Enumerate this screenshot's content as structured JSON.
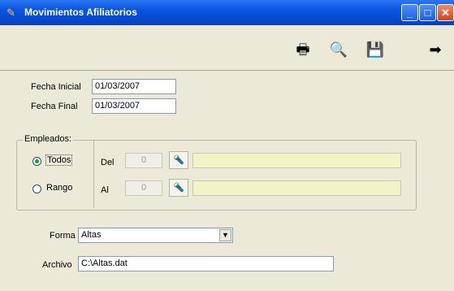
{
  "window": {
    "title": "Movimientos Afiliatorios",
    "minimize": "_",
    "maximize": "□",
    "close": "✕"
  },
  "toolbar": {
    "items": [
      {
        "icon": "printer-icon",
        "glyph": "🖶"
      },
      {
        "icon": "print-preview-icon",
        "glyph": "🔍"
      },
      {
        "icon": "save-icon",
        "glyph": "💾"
      },
      {
        "icon": "exit-icon",
        "glyph": "➡"
      }
    ]
  },
  "form": {
    "fecha_inicial_label": "Fecha Inicial",
    "fecha_inicial_value": "01/03/2007",
    "fecha_final_label": "Fecha Final",
    "fecha_final_value": "01/03/2007",
    "empleados_group": "Empleados:",
    "todos_label": "Todos",
    "rango_label": "Rango",
    "selected": "Todos",
    "del_label": "Del",
    "del_value": "0",
    "al_label": "Al",
    "al_value": "0",
    "forma_label": "Forma",
    "forma_value": "Altas",
    "archivo_label": "Archivo",
    "archivo_value": "C:\\Altas.dat"
  }
}
